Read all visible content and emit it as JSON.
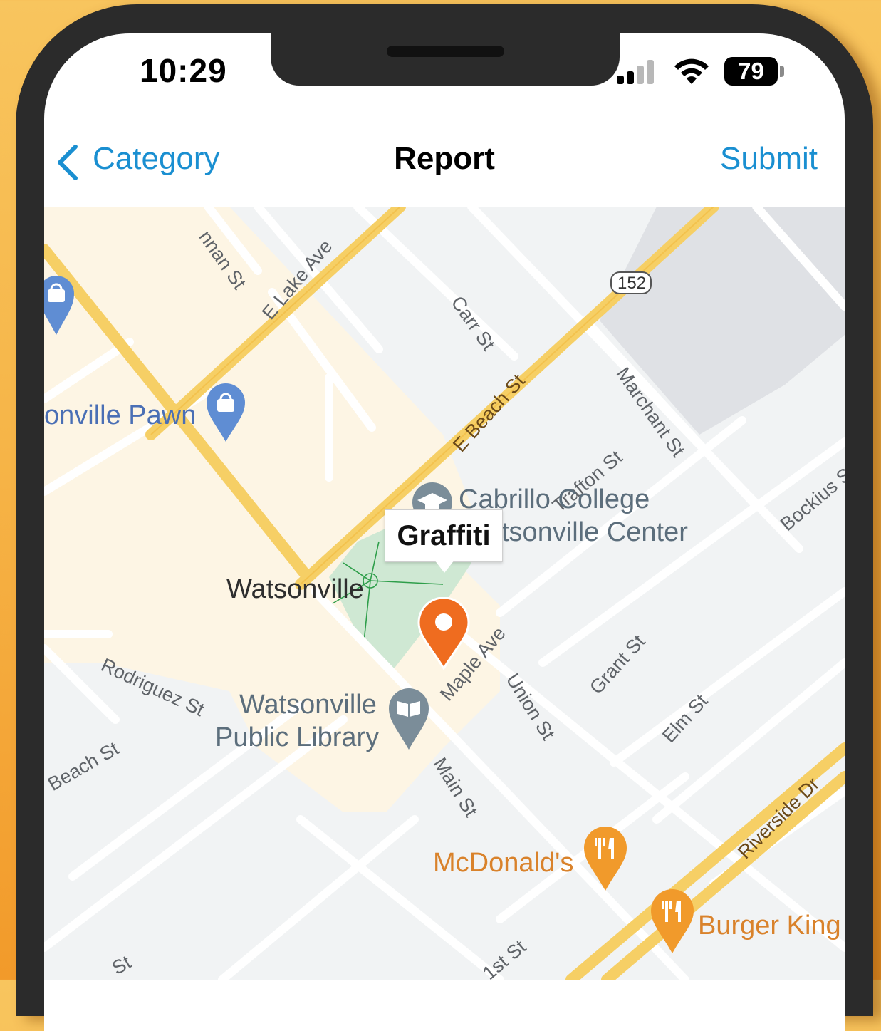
{
  "status_bar": {
    "time": "10:29",
    "battery": "79",
    "signal_bars": 2,
    "signal_icon": "cellular-signal-icon",
    "wifi_icon": "wifi-icon"
  },
  "nav": {
    "back_label": "Category",
    "back_icon": "chevron-left-icon",
    "title": "Report",
    "submit_label": "Submit",
    "accent_color": "#1a8fd1"
  },
  "map": {
    "route_shield": "152",
    "streets": [
      "nnan St",
      "E Lake Ave",
      "Carr St",
      "E Beach St",
      "Marchant St",
      "Trafton St",
      "Bockius St",
      "Rodriguez St",
      "Maple Ave",
      "Union St",
      "Grant St",
      "Elm St",
      "Beach St",
      "Main St",
      "Riverside Dr",
      "1st St",
      "St"
    ],
    "places": {
      "pawn": "onville Pawn",
      "college_line1": "Cabrillo College",
      "college_line2": "tsonville Center",
      "city": "Watsonville",
      "library_line1": "Watsonville",
      "library_line2": "Public Library",
      "mcdonalds": "McDonald's",
      "burger_king": "Burger King"
    },
    "marker_callout": "Graffiti",
    "marker_color": "#ef6c1f"
  }
}
